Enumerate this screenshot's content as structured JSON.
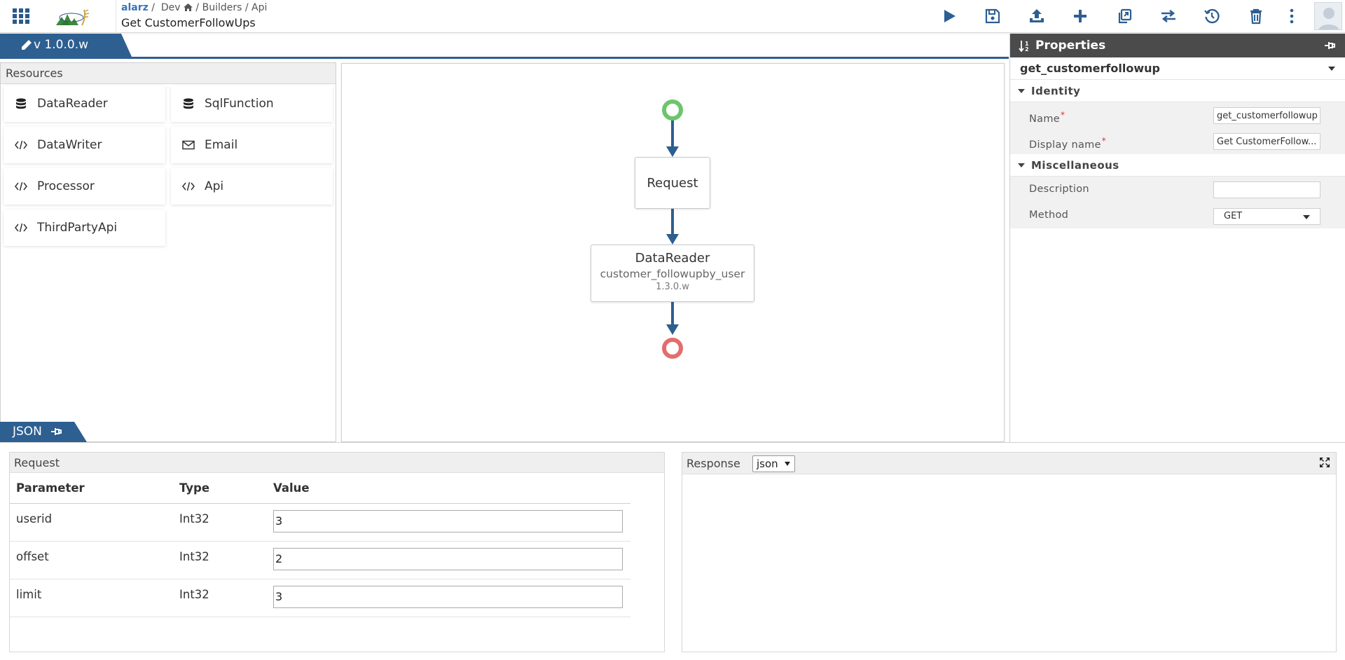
{
  "breadcrumb": {
    "org": "alarz",
    "sep": "/",
    "env": "Dev",
    "builders": "Builders",
    "api": "Api"
  },
  "page_title": "Get CustomerFollowUps",
  "toolbar": [
    "play-icon",
    "save-icon",
    "upload-icon",
    "plus-icon",
    "copy-icon",
    "swap-icon",
    "history-icon",
    "trash-icon",
    "more-icon"
  ],
  "version_tab": "v 1.0.0.w",
  "resources": {
    "header": "Resources",
    "items": [
      {
        "label": "DataReader",
        "icon": "database-icon"
      },
      {
        "label": "SqlFunction",
        "icon": "database-icon"
      },
      {
        "label": "DataWriter",
        "icon": "code-icon"
      },
      {
        "label": "Email",
        "icon": "envelope-icon"
      },
      {
        "label": "Processor",
        "icon": "code-icon"
      },
      {
        "label": "Api",
        "icon": "code-icon"
      },
      {
        "label": "ThirdPartyApi",
        "icon": "code-icon"
      }
    ]
  },
  "json_tab": "JSON",
  "canvas": {
    "request_node": "Request",
    "reader_node": {
      "title": "DataReader",
      "name": "customer_followupby_user",
      "version": "1.3.0.w"
    }
  },
  "properties": {
    "header": "Properties",
    "object": "get_customerfollowup",
    "identity": {
      "label": "Identity",
      "name_label": "Name",
      "name_value": "get_customerfollowup",
      "display_label": "Display name",
      "display_value": "Get CustomerFollow..."
    },
    "misc": {
      "label": "Miscellaneous",
      "description_label": "Description",
      "description_value": "",
      "method_label": "Method",
      "method_value": "GET"
    }
  },
  "request": {
    "header": "Request",
    "columns": [
      "Parameter",
      "Type",
      "Value"
    ],
    "rows": [
      {
        "param": "userid",
        "type": "Int32",
        "value": "3"
      },
      {
        "param": "offset",
        "type": "Int32",
        "value": "2"
      },
      {
        "param": "limit",
        "type": "Int32",
        "value": "3"
      }
    ]
  },
  "response": {
    "header": "Response",
    "format": "json"
  },
  "colors": {
    "accent": "#2d5f91",
    "start": "#6cc56c",
    "end": "#e46d6d",
    "edge": "#2d5f91",
    "header_dark": "#4b4b4b"
  }
}
